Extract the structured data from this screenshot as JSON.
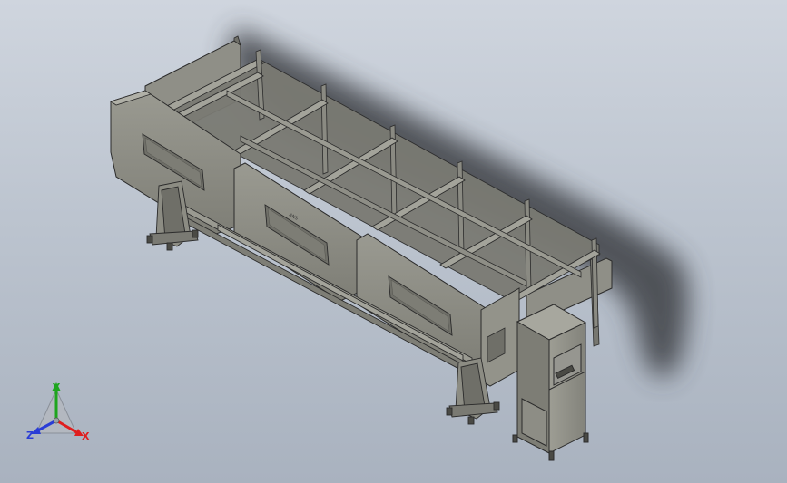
{
  "viewport": {
    "background_top": "#cfd5de",
    "background_bottom": "#a9b2bf",
    "model_color": "#8c8c83",
    "model_dark": "#6f6f68",
    "model_light": "#a3a39a",
    "edge_color": "#2b2b2b",
    "shadow_color": "#3c3f44"
  },
  "triad": {
    "x_label": "X",
    "y_label": "Y",
    "z_label": "Z",
    "x_color": "#e01e1e",
    "y_color": "#1ea51e",
    "z_color": "#2a3dd6"
  },
  "model": {
    "guard_label": "ANS",
    "guard_label_2": "ANS"
  }
}
